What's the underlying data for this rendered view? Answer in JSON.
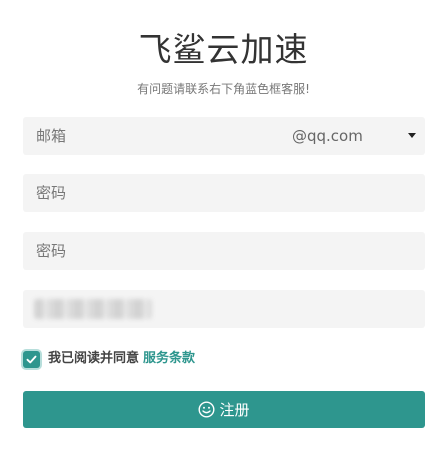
{
  "brand": {
    "title": "飞鲨云加速",
    "subtitle": "有问题请联系右下角蓝色框客服!"
  },
  "form": {
    "email_placeholder": "邮箱",
    "email_domain_selected": "@qq.com",
    "password_placeholder": "密码",
    "password_confirm_placeholder": "密码",
    "captcha_value": ""
  },
  "agreement": {
    "checked": true,
    "label": "我已阅读并同意",
    "link_text": "服务条款"
  },
  "submit": {
    "label": "注册",
    "icon": "smile-icon"
  },
  "colors": {
    "accent": "#2e968e",
    "field_bg": "#f4f4f4",
    "title": "#333333",
    "subtitle": "#777777"
  }
}
